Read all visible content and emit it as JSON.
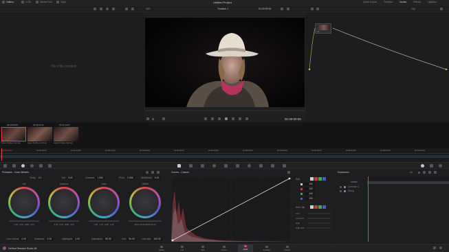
{
  "topbar": {
    "items": [
      "Gallery",
      "LUTs",
      "Media Pool",
      "Clips"
    ],
    "zoom": "38%",
    "timeline": "Timeline 1",
    "timecode": "01:00:00:00",
    "clip_select": "Clip",
    "project_title": "Untitled Project",
    "right_items": [
      "Quick Export",
      "Timeline",
      "Nodes",
      "Effects",
      "Lightbox"
    ]
  },
  "gallery": {
    "empty_text": "No stills created"
  },
  "viewer": {
    "timecode": "01:00:00:00"
  },
  "nodes": {
    "node_label": "01"
  },
  "clips": [
    {
      "timecode": "03:40:09:09",
      "name": "Apple ProRes 422 HQ"
    },
    {
      "timecode": "09:49:43:21",
      "name": "Apple ProRes 422 HQ"
    },
    {
      "timecode": "01:01:13:07",
      "name": "Apple ProRes 422 HQ"
    }
  ],
  "ruler_marks": [
    "01:00:00:00",
    "01:00:05:00",
    "01:00:10:00",
    "01:00:15:00",
    "01:00:20:00",
    "01:00:25:00",
    "01:00:30:00",
    "01:00:35:00",
    "01:00:40:00",
    "01:00:45:00",
    "01:00:50:00",
    "01:00:55:00",
    "01:01:00:00"
  ],
  "wheels": {
    "title": "Primaries - Color Wheels",
    "params_top": [
      {
        "label": "Temp",
        "value": "0.0"
      },
      {
        "label": "Tint",
        "value": "0.00"
      },
      {
        "label": "Contrast",
        "value": "1.000"
      },
      {
        "label": "Pivot",
        "value": "0.435"
      },
      {
        "label": "Mid/Detail",
        "value": "0.00"
      }
    ],
    "items": [
      {
        "name": "Lift",
        "values": [
          "0.00",
          "0.00",
          "0.00",
          "0.00"
        ]
      },
      {
        "name": "Gamma",
        "values": [
          "0.00",
          "0.00",
          "0.00",
          "0.00"
        ]
      },
      {
        "name": "Gain",
        "values": [
          "1.00",
          "1.00",
          "1.00",
          "1.00"
        ]
      },
      {
        "name": "Offset",
        "values": [
          "25.00",
          "25.00",
          "25.00",
          "25.00"
        ]
      }
    ],
    "params_bottom": [
      {
        "label": "Color Boost",
        "value": "0.00"
      },
      {
        "label": "Shadows",
        "value": "0.00"
      },
      {
        "label": "Highlights",
        "value": "0.00"
      },
      {
        "label": "Saturation",
        "value": "50.00"
      },
      {
        "label": "Hue",
        "value": "50.00"
      },
      {
        "label": "Lum Mix",
        "value": "100.00"
      }
    ]
  },
  "curves": {
    "title": "Curves - Custom"
  },
  "edit": {
    "label": "Edit",
    "values": [
      "100",
      "100",
      "100",
      "100"
    ],
    "soft_clip_label": "Soft Clip",
    "soft_rows": [
      "Low",
      "Low Soft",
      "High",
      "High Soft"
    ]
  },
  "keyframes": {
    "title": "Keyframes",
    "zoom_value": "All",
    "tracks": [
      "Master",
      "Corrector 1",
      "Sizing"
    ]
  },
  "bottom": {
    "app_name": "DaVinci Resolve Studio 18",
    "pages": [
      "Media",
      "Cut",
      "Edit",
      "Fusion",
      "Color",
      "Fairlight",
      "Deliver"
    ],
    "active_page": "Color"
  },
  "colors": {
    "accent": "#e2434e",
    "bg": "#1b1b1d",
    "panel": "#1e1e21"
  }
}
